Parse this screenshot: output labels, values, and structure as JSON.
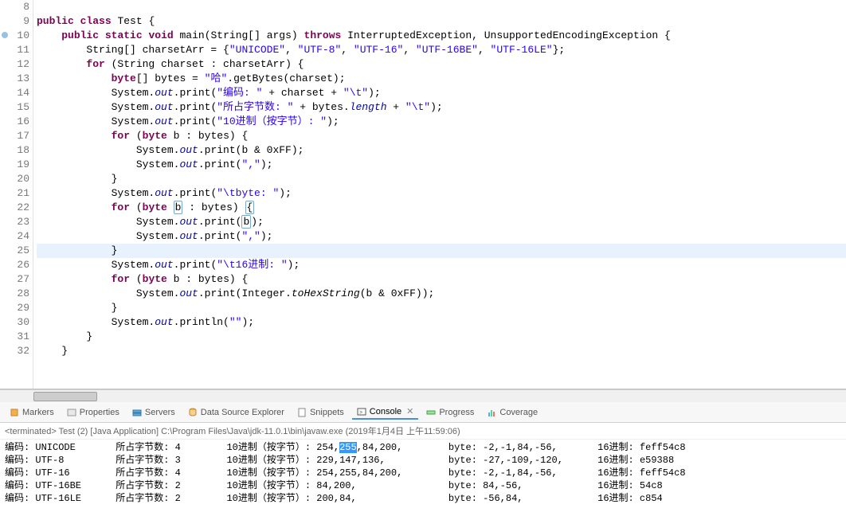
{
  "editor": {
    "lines": [
      {
        "n": "8",
        "tokens": []
      },
      {
        "n": "9",
        "tokens": [
          {
            "t": "public",
            "c": "kw"
          },
          {
            "t": " "
          },
          {
            "t": "class",
            "c": "kw"
          },
          {
            "t": " Test {"
          }
        ]
      },
      {
        "n": "10",
        "marker": true,
        "tokens": [
          {
            "t": "    "
          },
          {
            "t": "public",
            "c": "kw"
          },
          {
            "t": " "
          },
          {
            "t": "static",
            "c": "kw"
          },
          {
            "t": " "
          },
          {
            "t": "void",
            "c": "kw"
          },
          {
            "t": " main(String[] args) "
          },
          {
            "t": "throws",
            "c": "kw"
          },
          {
            "t": " InterruptedException, UnsupportedEncodingException {"
          }
        ]
      },
      {
        "n": "11",
        "tokens": [
          {
            "t": "        String[] charsetArr = {"
          },
          {
            "t": "\"UNICODE\"",
            "c": "str"
          },
          {
            "t": ", "
          },
          {
            "t": "\"UTF-8\"",
            "c": "str"
          },
          {
            "t": ", "
          },
          {
            "t": "\"UTF-16\"",
            "c": "str"
          },
          {
            "t": ", "
          },
          {
            "t": "\"UTF-16BE\"",
            "c": "str"
          },
          {
            "t": ", "
          },
          {
            "t": "\"UTF-16LE\"",
            "c": "str"
          },
          {
            "t": "};"
          }
        ]
      },
      {
        "n": "12",
        "tokens": [
          {
            "t": "        "
          },
          {
            "t": "for",
            "c": "kw"
          },
          {
            "t": " (String charset : charsetArr) {"
          }
        ]
      },
      {
        "n": "13",
        "tokens": [
          {
            "t": "            "
          },
          {
            "t": "byte",
            "c": "kw"
          },
          {
            "t": "[] bytes = "
          },
          {
            "t": "\"哈\"",
            "c": "str"
          },
          {
            "t": ".getBytes(charset);"
          }
        ]
      },
      {
        "n": "14",
        "tokens": [
          {
            "t": "            System."
          },
          {
            "t": "out",
            "c": "fld"
          },
          {
            "t": ".print("
          },
          {
            "t": "\"编码: \"",
            "c": "str"
          },
          {
            "t": " + charset + "
          },
          {
            "t": "\"\\t\"",
            "c": "str"
          },
          {
            "t": ");"
          }
        ]
      },
      {
        "n": "15",
        "tokens": [
          {
            "t": "            System."
          },
          {
            "t": "out",
            "c": "fld"
          },
          {
            "t": ".print("
          },
          {
            "t": "\"所占字节数: \"",
            "c": "str"
          },
          {
            "t": " + bytes."
          },
          {
            "t": "length",
            "c": "fld"
          },
          {
            "t": " + "
          },
          {
            "t": "\"\\t\"",
            "c": "str"
          },
          {
            "t": ");"
          }
        ]
      },
      {
        "n": "16",
        "tokens": [
          {
            "t": "            System."
          },
          {
            "t": "out",
            "c": "fld"
          },
          {
            "t": ".print("
          },
          {
            "t": "\"10进制（按字节）: \"",
            "c": "str"
          },
          {
            "t": ");"
          }
        ]
      },
      {
        "n": "17",
        "tokens": [
          {
            "t": "            "
          },
          {
            "t": "for",
            "c": "kw"
          },
          {
            "t": " ("
          },
          {
            "t": "byte",
            "c": "kw"
          },
          {
            "t": " b : bytes) {"
          }
        ]
      },
      {
        "n": "18",
        "tokens": [
          {
            "t": "                System."
          },
          {
            "t": "out",
            "c": "fld"
          },
          {
            "t": ".print(b & 0xFF);"
          }
        ]
      },
      {
        "n": "19",
        "tokens": [
          {
            "t": "                System."
          },
          {
            "t": "out",
            "c": "fld"
          },
          {
            "t": ".print("
          },
          {
            "t": "\",\"",
            "c": "str"
          },
          {
            "t": ");"
          }
        ]
      },
      {
        "n": "20",
        "tokens": [
          {
            "t": "            }"
          }
        ]
      },
      {
        "n": "21",
        "tokens": [
          {
            "t": "            System."
          },
          {
            "t": "out",
            "c": "fld"
          },
          {
            "t": ".print("
          },
          {
            "t": "\"\\tbyte: \"",
            "c": "str"
          },
          {
            "t": ");"
          }
        ]
      },
      {
        "n": "22",
        "tokens": [
          {
            "t": "            "
          },
          {
            "t": "for",
            "c": "kw"
          },
          {
            "t": " ("
          },
          {
            "t": "byte",
            "c": "kw"
          },
          {
            "t": " "
          },
          {
            "t": "b",
            "box": true
          },
          {
            "t": " : bytes) "
          },
          {
            "t": "{",
            "box": true
          }
        ]
      },
      {
        "n": "23",
        "tokens": [
          {
            "t": "                System."
          },
          {
            "t": "out",
            "c": "fld"
          },
          {
            "t": ".print("
          },
          {
            "t": "b",
            "box": true
          },
          {
            "t": ");"
          }
        ]
      },
      {
        "n": "24",
        "tokens": [
          {
            "t": "                System."
          },
          {
            "t": "out",
            "c": "fld"
          },
          {
            "t": ".print("
          },
          {
            "t": "\",\"",
            "c": "str"
          },
          {
            "t": ");"
          }
        ]
      },
      {
        "n": "25",
        "hl": true,
        "tokens": [
          {
            "t": "            }"
          }
        ]
      },
      {
        "n": "26",
        "tokens": [
          {
            "t": "            System."
          },
          {
            "t": "out",
            "c": "fld"
          },
          {
            "t": ".print("
          },
          {
            "t": "\"\\t16进制: \"",
            "c": "str"
          },
          {
            "t": ");"
          }
        ]
      },
      {
        "n": "27",
        "tokens": [
          {
            "t": "            "
          },
          {
            "t": "for",
            "c": "kw"
          },
          {
            "t": " ("
          },
          {
            "t": "byte",
            "c": "kw"
          },
          {
            "t": " b : bytes) {"
          }
        ]
      },
      {
        "n": "28",
        "tokens": [
          {
            "t": "                System."
          },
          {
            "t": "out",
            "c": "fld"
          },
          {
            "t": ".print(Integer."
          },
          {
            "t": "toHexString",
            "c": "mth"
          },
          {
            "t": "(b & 0xFF));"
          }
        ]
      },
      {
        "n": "29",
        "tokens": [
          {
            "t": "            }"
          }
        ]
      },
      {
        "n": "30",
        "tokens": [
          {
            "t": "            System."
          },
          {
            "t": "out",
            "c": "fld"
          },
          {
            "t": ".println("
          },
          {
            "t": "\"\"",
            "c": "str"
          },
          {
            "t": ");"
          }
        ]
      },
      {
        "n": "31",
        "tokens": [
          {
            "t": "        }"
          }
        ]
      },
      {
        "n": "32",
        "tokens": [
          {
            "t": "    }"
          }
        ]
      }
    ]
  },
  "views": {
    "markers": "Markers",
    "properties": "Properties",
    "servers": "Servers",
    "dse": "Data Source Explorer",
    "snippets": "Snippets",
    "console": "Console",
    "console_x": "✕",
    "progress": "Progress",
    "coverage": "Coverage"
  },
  "terminated": "<terminated> Test (2) [Java Application] C:\\Program Files\\Java\\jdk-11.0.1\\bin\\javaw.exe (2019年1月4日 上午11:59:06)",
  "console": {
    "rows": [
      {
        "enc": "编码: UNICODE",
        "bytes": "所占字节数: 4",
        "dec_pre": "10进制（按字节）: 254,",
        "sel": "255",
        "dec_post": ",84,200,",
        "byte": "byte: -2,-1,84,-56,",
        "hex": "16进制: feff54c8"
      },
      {
        "enc": "编码: UTF-8",
        "bytes": "所占字节数: 3",
        "dec_pre": "10进制（按字节）: 229,147,136,",
        "sel": "",
        "dec_post": "",
        "byte": "byte: -27,-109,-120,",
        "hex": "16进制: e59388"
      },
      {
        "enc": "编码: UTF-16",
        "bytes": "所占字节数: 4",
        "dec_pre": "10进制（按字节）: 254,255,84,200,",
        "sel": "",
        "dec_post": "",
        "byte": "byte: -2,-1,84,-56,",
        "hex": "16进制: feff54c8"
      },
      {
        "enc": "编码: UTF-16BE",
        "bytes": "所占字节数: 2",
        "dec_pre": "10进制（按字节）: 84,200,",
        "sel": "",
        "dec_post": "",
        "byte": "byte: 84,-56,",
        "hex": "16进制: 54c8"
      },
      {
        "enc": "编码: UTF-16LE",
        "bytes": "所占字节数: 2",
        "dec_pre": "10进制（按字节）: 200,84,",
        "sel": "",
        "dec_post": "",
        "byte": "byte: -56,84,",
        "hex": "16进制: c854"
      }
    ]
  }
}
